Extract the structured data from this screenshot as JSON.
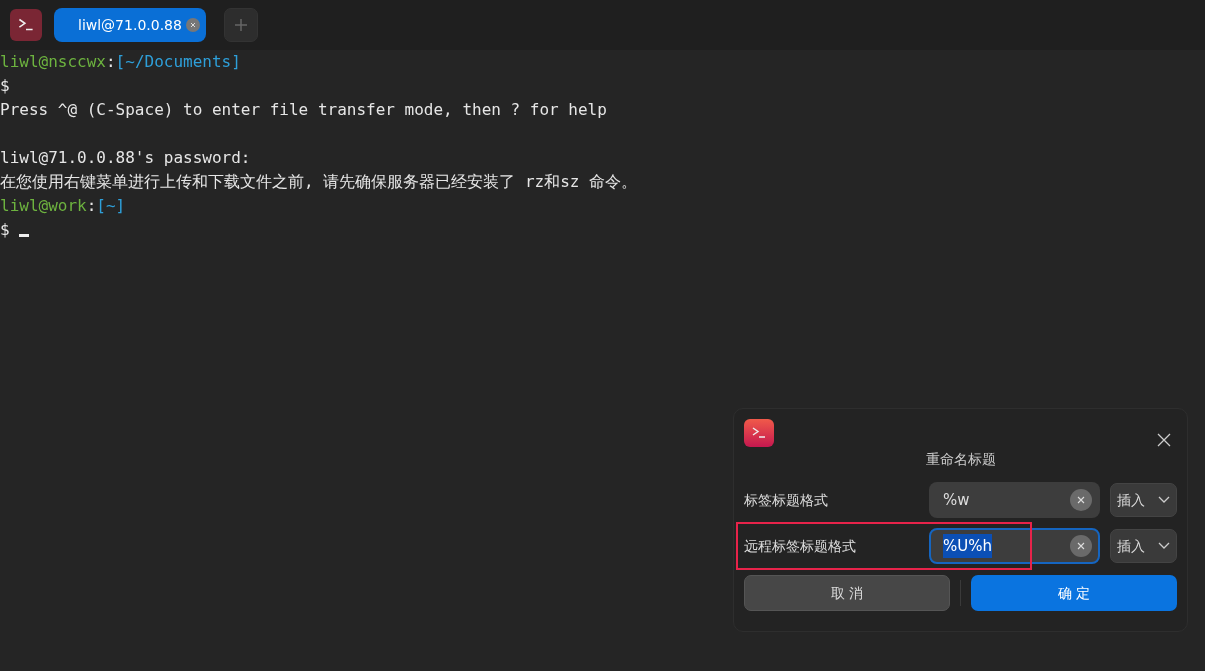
{
  "tabs": [
    {
      "label": "liwl@71.0.0.88",
      "selected": true
    }
  ],
  "terminal": {
    "lines": [
      [
        {
          "kind": "user",
          "text": "liwl@nsccwx"
        },
        {
          "kind": "plain",
          "text": ":"
        },
        {
          "kind": "path",
          "text": "[~/Documents]"
        }
      ],
      [
        {
          "kind": "plain",
          "text": "$"
        }
      ],
      [
        {
          "kind": "plain",
          "text": "Press ^@ (C-Space) to enter file transfer mode, then ? for help"
        }
      ],
      [
        {
          "kind": "blank"
        }
      ],
      [
        {
          "kind": "plain",
          "text": "liwl@71.0.0.88's password:"
        }
      ],
      [
        {
          "kind": "plain",
          "text": "在您使用右键菜单进行上传和下载文件之前, 请先确保服务器已经安装了 rz和sz 命令。"
        }
      ],
      [
        {
          "kind": "user",
          "text": "liwl@work"
        },
        {
          "kind": "plain",
          "text": ":"
        },
        {
          "kind": "path",
          "text": "[~]"
        }
      ],
      [
        {
          "kind": "plain",
          "text": "$ "
        },
        {
          "kind": "cursor"
        }
      ]
    ]
  },
  "dialog": {
    "title": "重命名标题",
    "fields": [
      {
        "label": "标签标题格式",
        "value": "%w",
        "focused": false,
        "value_selected": false,
        "highlighted": false,
        "insert": "插入"
      },
      {
        "label": "远程标签标题格式",
        "value": "%U%h",
        "focused": true,
        "value_selected": true,
        "highlighted": true,
        "insert": "插入"
      }
    ],
    "buttons": [
      {
        "label": "取 消",
        "kind": "secondary"
      },
      {
        "label": "确 定",
        "kind": "primary"
      }
    ]
  }
}
